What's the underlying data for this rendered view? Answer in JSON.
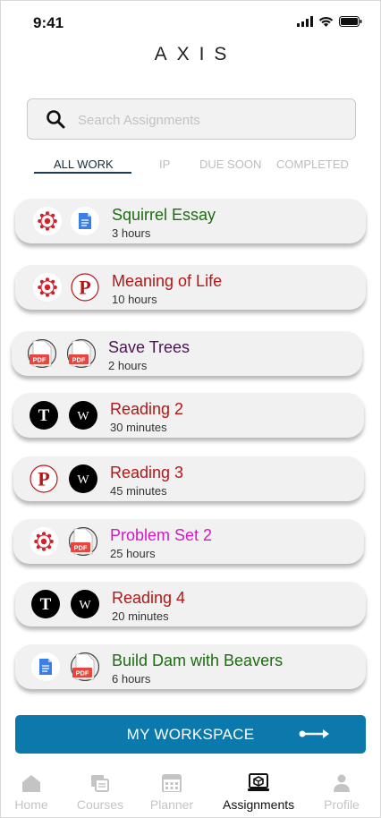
{
  "status_bar": {
    "time": "9:41"
  },
  "app": {
    "brand": "AXIS"
  },
  "search": {
    "placeholder": "Search Assignments",
    "value": ""
  },
  "tabs": [
    {
      "label": "ALL WORK",
      "active": true
    },
    {
      "label": "IP",
      "active": false
    },
    {
      "label": "DUE SOON",
      "active": false
    },
    {
      "label": "COMPLETED",
      "active": false
    }
  ],
  "assignments": [
    {
      "title": "Squirrel Essay",
      "duration": "3 hours",
      "color": "#1e6b12",
      "icons": [
        "canvas-icon",
        "google-docs-icon"
      ]
    },
    {
      "title": "Meaning of Life",
      "duration": "10 hours",
      "color": "#b81414",
      "icons": [
        "canvas-icon",
        "pearson-icon"
      ]
    },
    {
      "title": "Save Trees",
      "duration": "2 hours",
      "color": "#4a1552",
      "icons": [
        "pdf-icon",
        "pdf-icon"
      ]
    },
    {
      "title": "Reading 2",
      "duration": "30 minutes",
      "color": "#b81414",
      "icons": [
        "nyt-icon",
        "wikipedia-icon"
      ]
    },
    {
      "title": "Reading 3",
      "duration": "45 minutes",
      "color": "#b81414",
      "icons": [
        "pearson-icon",
        "wikipedia-icon"
      ]
    },
    {
      "title": "Problem Set 2",
      "duration": "25 hours",
      "color": "#d418c4",
      "icons": [
        "canvas-icon",
        "pdf-icon"
      ]
    },
    {
      "title": "Reading 4",
      "duration": "20 minutes",
      "color": "#b81414",
      "icons": [
        "nyt-icon",
        "wikipedia-icon"
      ]
    },
    {
      "title": "Build Dam with Beavers",
      "duration": "6 hours",
      "color": "#1e6b12",
      "icons": [
        "google-docs-icon",
        "pdf-icon"
      ]
    }
  ],
  "workspace_button": {
    "label": "MY WORKSPACE"
  },
  "bottom_nav": [
    {
      "label": "Home",
      "icon": "home-icon",
      "active": false
    },
    {
      "label": "Courses",
      "icon": "courses-icon",
      "active": false
    },
    {
      "label": "Planner",
      "icon": "planner-icon",
      "active": false
    },
    {
      "label": "Assignments",
      "icon": "assignments-icon",
      "active": true
    },
    {
      "label": "Profile",
      "icon": "profile-icon",
      "active": false
    }
  ],
  "icon_glyphs": {
    "pdf_label": "PDF",
    "pearson_letter": "P",
    "wiki_letter": "W",
    "nyt_letter": "T"
  },
  "colors": {
    "accent": "#0b79ab",
    "canvas_red": "#d21f2a",
    "pearson_red": "#b81414",
    "pdf_red": "#e8453c",
    "docs_blue": "#3a7ee8"
  }
}
